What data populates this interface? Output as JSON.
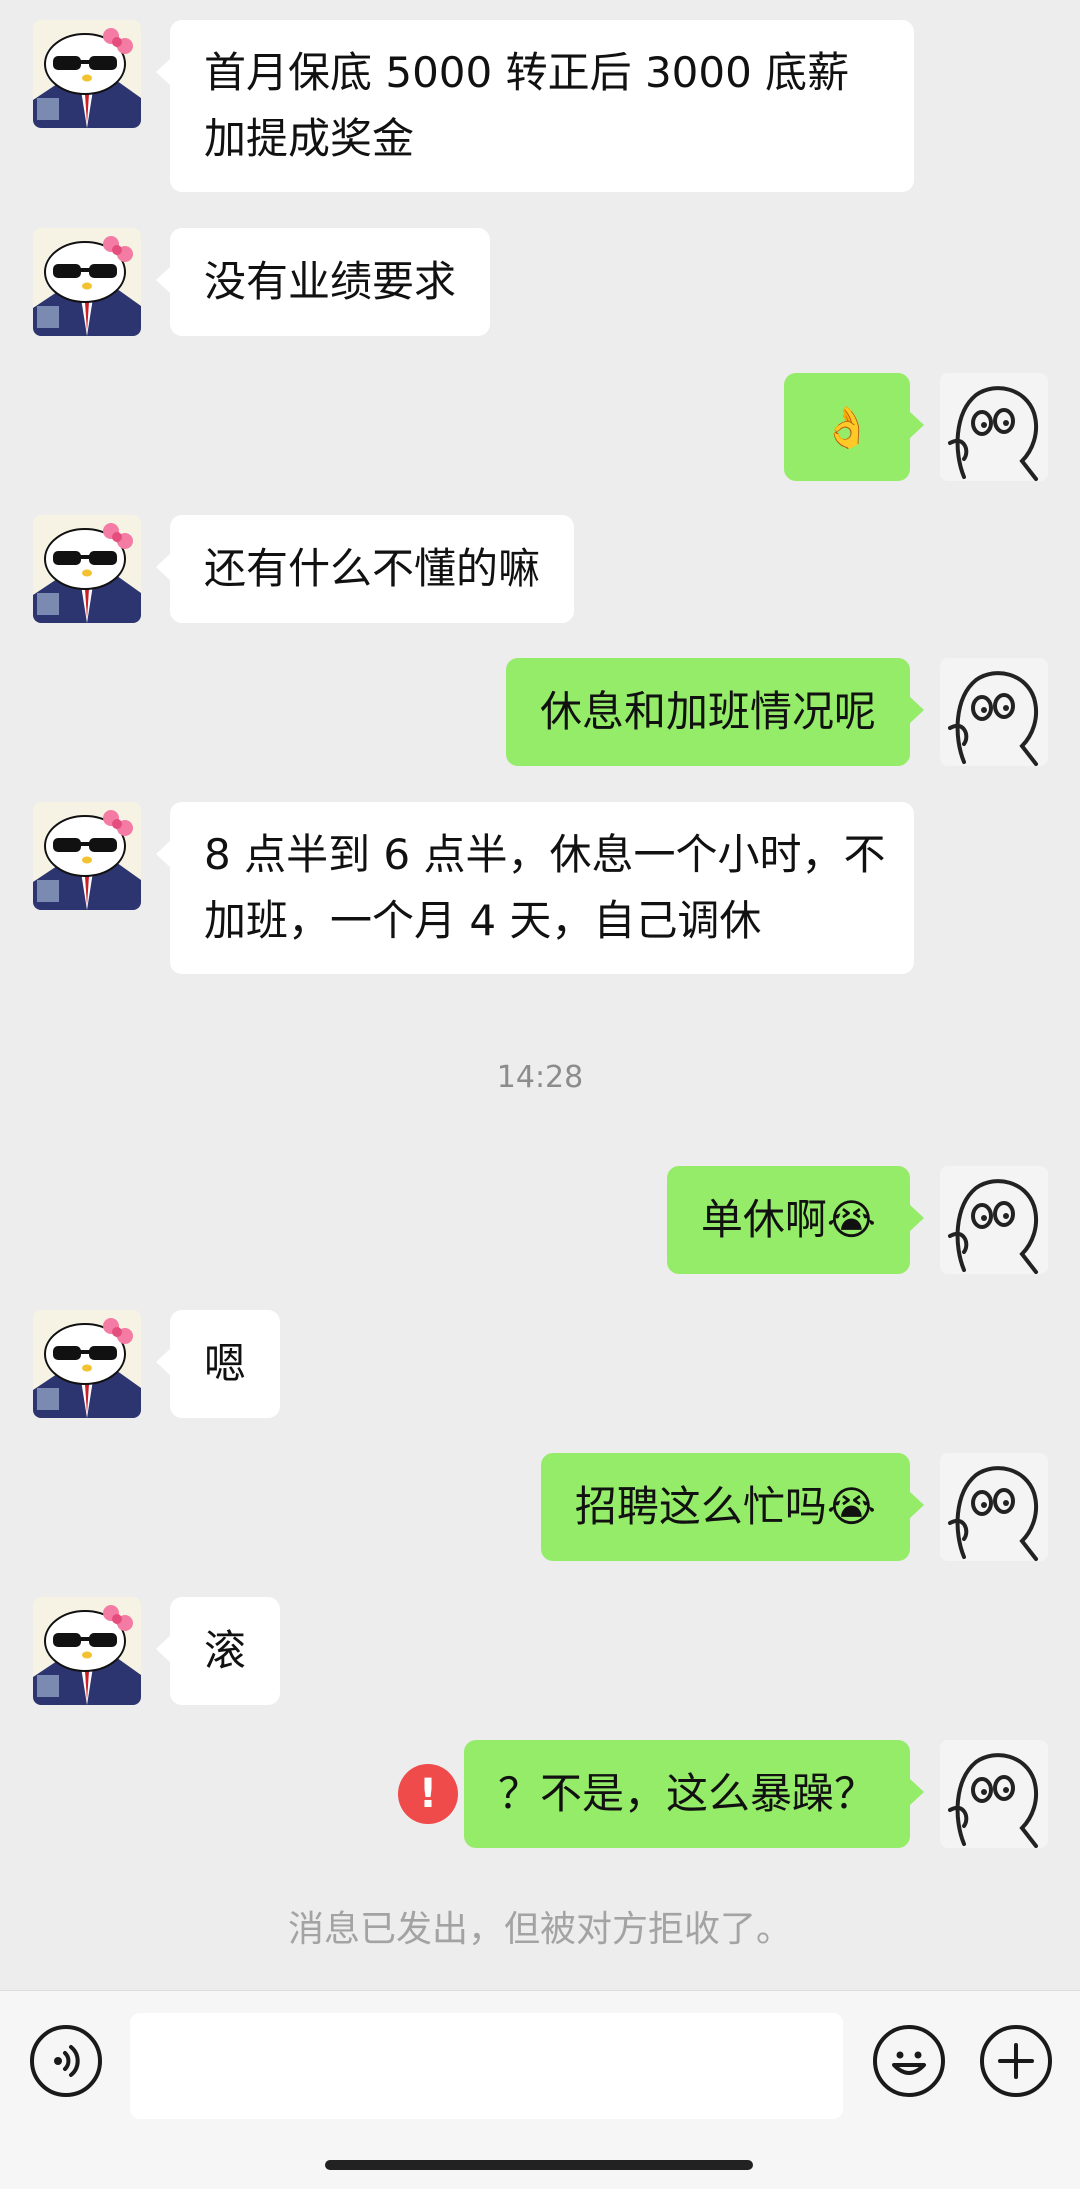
{
  "messages": [
    {
      "side": "left",
      "text_lines": [
        "首月保底 5000 转正后 3000 底薪",
        "加提成奖金"
      ]
    },
    {
      "side": "left",
      "text": "没有业绩要求"
    },
    {
      "side": "right",
      "text": "👌"
    },
    {
      "side": "left",
      "text": "还有什么不懂的嘛"
    },
    {
      "side": "right",
      "text": "休息和加班情况呢"
    },
    {
      "side": "left",
      "text_lines": [
        "8 点半到 6 点半，休息一个小时，不",
        "加班，一个月 4 天，自己调休"
      ]
    },
    {
      "timestamp": "14:28"
    },
    {
      "side": "right",
      "text": "单休啊😭"
    },
    {
      "side": "left",
      "text": "嗯"
    },
    {
      "side": "right",
      "text": "招聘这么忙吗😭"
    },
    {
      "side": "left",
      "text": "滚"
    },
    {
      "side": "right",
      "text": "？不是，这么暴躁？",
      "failed": true,
      "fail_icon": "!"
    }
  ],
  "system_notice": "消息已发出，但被对方拒收了。",
  "input_bar": {
    "voice_icon": "voice-icon",
    "emoji_icon": "emoji-icon",
    "plus_icon": "plus-icon",
    "input_value": ""
  },
  "colors": {
    "background": "#ededed",
    "bubble_self": "#95ec69",
    "bubble_other": "#ffffff",
    "error": "#ef4b4b"
  }
}
